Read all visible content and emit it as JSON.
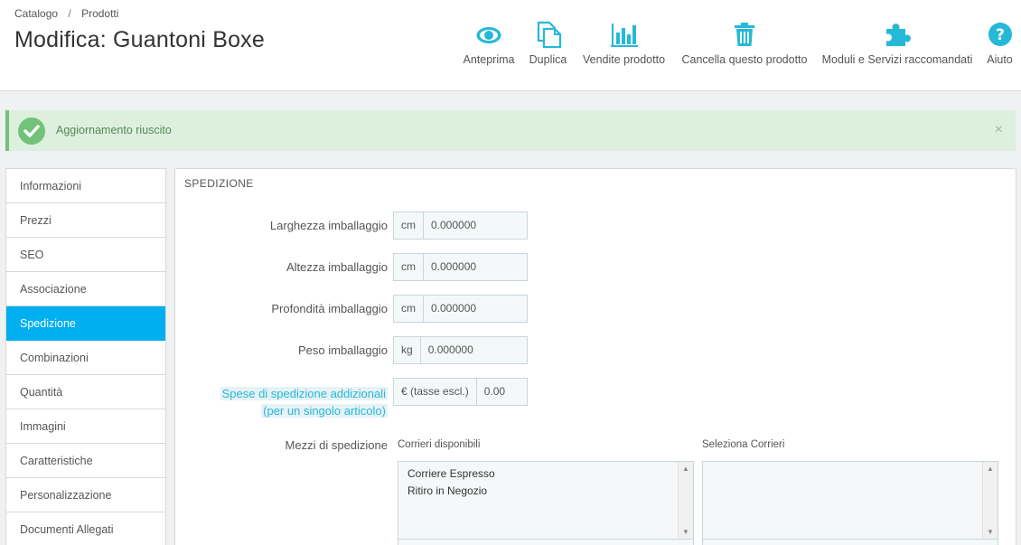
{
  "breadcrumb": {
    "item1": "Catalogo",
    "separator": "/",
    "item2": "Prodotti"
  },
  "page_title": "Modifica: Guantoni Boxe",
  "toolbar": {
    "preview": "Anteprima",
    "duplicate": "Duplica",
    "sales": "Vendite prodotto",
    "delete": "Cancella questo prodotto",
    "modules": "Moduli e Servizi raccomandati",
    "help": "Aiuto",
    "icon_color": "#25b9d7"
  },
  "alert": {
    "text": "Aggiornamento riuscito",
    "close": "×"
  },
  "tabs": [
    "Informazioni",
    "Prezzi",
    "SEO",
    "Associazione",
    "Spedizione",
    "Combinazioni",
    "Quantità",
    "Immagini",
    "Caratteristiche",
    "Personalizzazione",
    "Documenti Allegati"
  ],
  "active_tab": "Spedizione",
  "panel": {
    "heading": "SPEDIZIONE",
    "width": {
      "label": "Larghezza imballaggio",
      "unit": "cm",
      "value": "0.000000"
    },
    "height": {
      "label": "Altezza imballaggio",
      "unit": "cm",
      "value": "0.000000"
    },
    "depth": {
      "label": "Profondità imballaggio",
      "unit": "cm",
      "value": "0.000000"
    },
    "weight": {
      "label": "Peso imballaggio",
      "unit": "kg",
      "value": "0.000000"
    },
    "additional": {
      "label_line1": "Spese di spedizione addizionali",
      "label_line2": "(per un singolo articolo)",
      "unit": "€ (tasse escl.)",
      "value": "0.00"
    },
    "carriers": {
      "label": "Mezzi di spedizione",
      "available_title": "Corrieri disponibili",
      "selected_title": "Seleziona Corrieri",
      "available": [
        "Corriere Espresso",
        "Ritiro in Negozio"
      ]
    }
  }
}
